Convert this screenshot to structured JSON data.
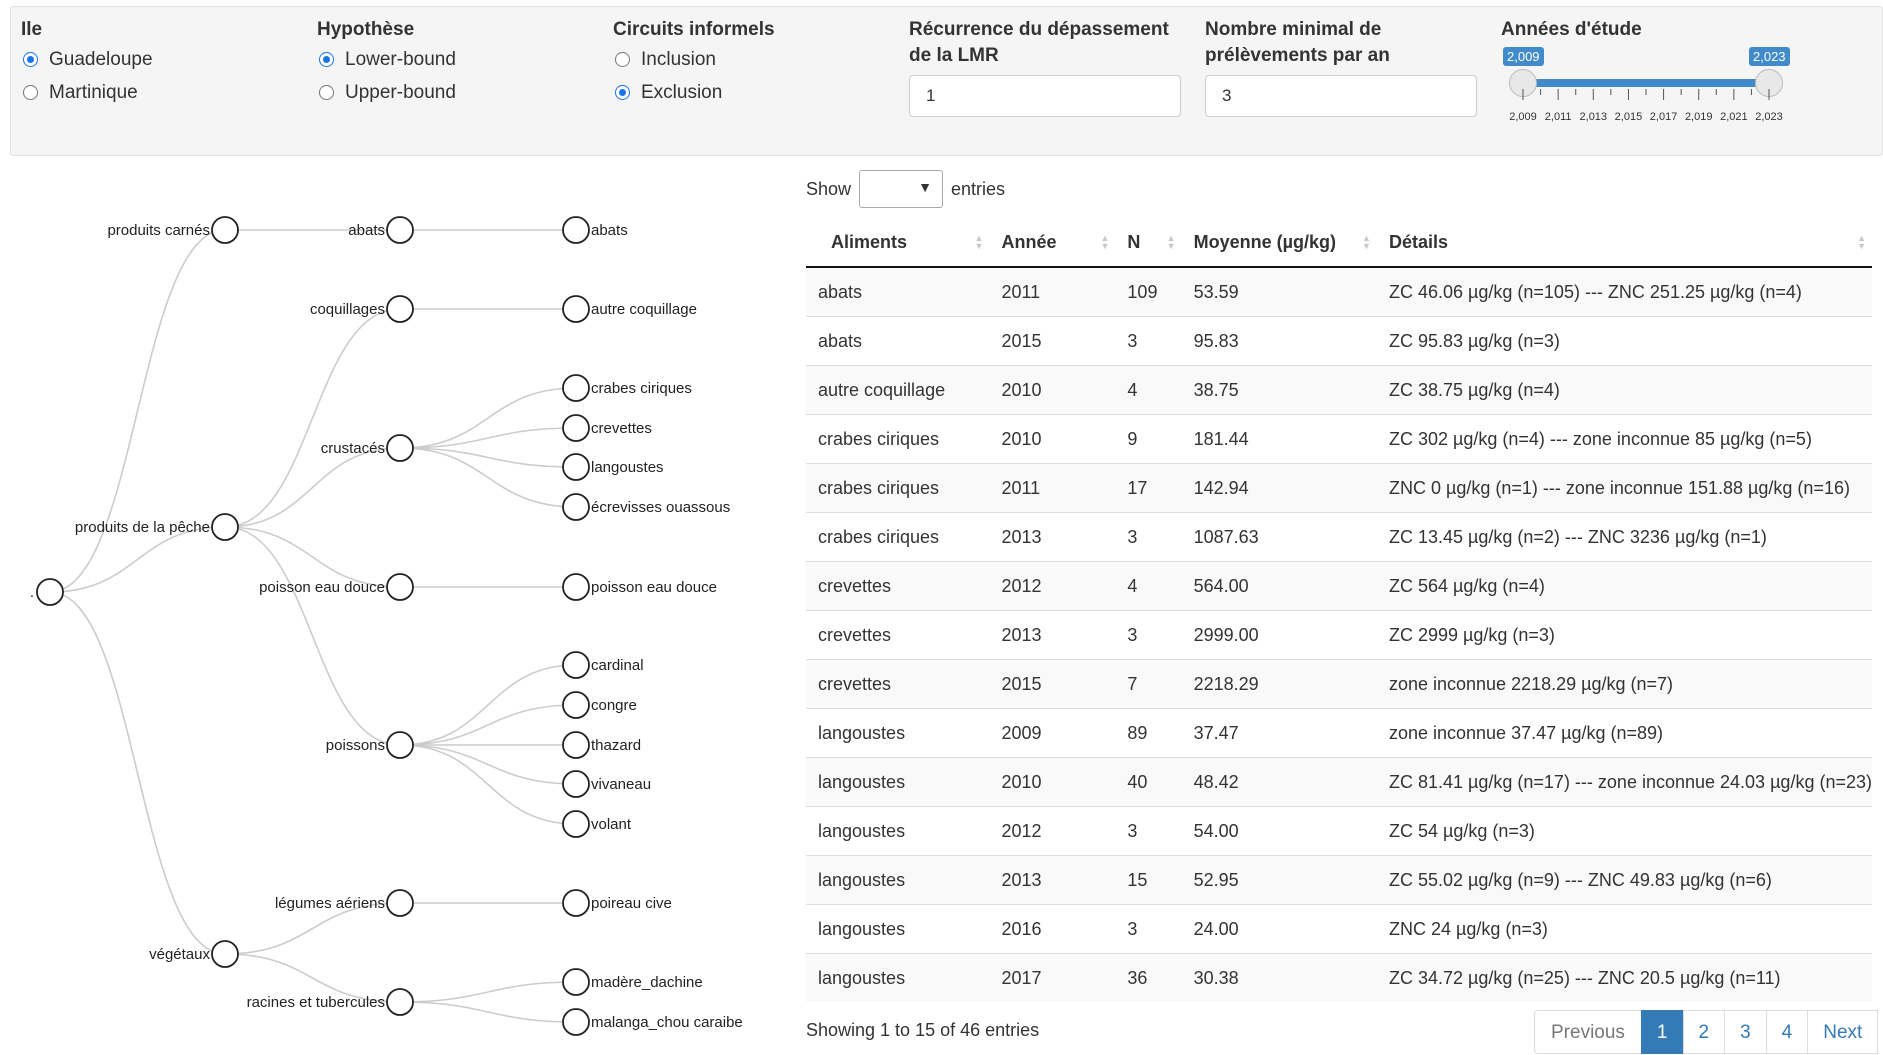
{
  "filters": {
    "ile": {
      "label": "Ile",
      "options": [
        "Guadeloupe",
        "Martinique"
      ],
      "selected": "Guadeloupe"
    },
    "hypothese": {
      "label": "Hypothèse",
      "options": [
        "Lower-bound",
        "Upper-bound"
      ],
      "selected": "Lower-bound"
    },
    "circuits": {
      "label": "Circuits informels",
      "options": [
        "Inclusion",
        "Exclusion"
      ],
      "selected": "Exclusion"
    },
    "recurrence": {
      "label_line1": "Récurrence du dépassement",
      "label_line2": "de la LMR",
      "value": "1"
    },
    "nombre": {
      "label_line1": "Nombre minimal de",
      "label_line2": "prélèvements par an",
      "value": "3"
    },
    "annees": {
      "label": "Années d'étude",
      "min_label": "2,009",
      "max_label": "2,023",
      "from": 2009,
      "to": 2023,
      "min": 2009,
      "max": 2023,
      "ticks": [
        "2,009",
        "2,011",
        "2,013",
        "2,015",
        "2,017",
        "2,019",
        "2,021",
        "2,023"
      ]
    }
  },
  "tree": {
    "root": ".",
    "level1": [
      "produits carnés",
      "produits de la pêche",
      "végétaux"
    ],
    "level2": [
      "abats",
      "coquillages",
      "crustacés",
      "poisson eau douce",
      "poissons",
      "légumes aériens",
      "racines et tubercules"
    ],
    "leaves": [
      "abats",
      "autre coquillage",
      "crabes ciriques",
      "crevettes",
      "langoustes",
      "écrevisses ouassous",
      "poisson eau douce",
      "cardinal",
      "congre",
      "thazard",
      "vivaneau",
      "volant",
      "poireau cive",
      "madère_dachine",
      "malanga_chou caraibe"
    ]
  },
  "table": {
    "show_label": "Show",
    "entries_label": "entries",
    "headers": [
      "Aliments",
      "Année",
      "N",
      "Moyenne (µg/kg)",
      "Détails"
    ],
    "rows": [
      [
        "abats",
        "2011",
        "109",
        "53.59",
        "ZC 46.06 µg/kg (n=105) --- ZNC 251.25 µg/kg (n=4)"
      ],
      [
        "abats",
        "2015",
        "3",
        "95.83",
        "ZC 95.83 µg/kg (n=3)"
      ],
      [
        "autre coquillage",
        "2010",
        "4",
        "38.75",
        "ZC 38.75 µg/kg (n=4)"
      ],
      [
        "crabes ciriques",
        "2010",
        "9",
        "181.44",
        "ZC 302 µg/kg (n=4) --- zone inconnue 85 µg/kg (n=5)"
      ],
      [
        "crabes ciriques",
        "2011",
        "17",
        "142.94",
        "ZNC 0 µg/kg (n=1) --- zone inconnue 151.88 µg/kg (n=16)"
      ],
      [
        "crabes ciriques",
        "2013",
        "3",
        "1087.63",
        "ZC 13.45 µg/kg (n=2) --- ZNC 3236 µg/kg (n=1)"
      ],
      [
        "crevettes",
        "2012",
        "4",
        "564.00",
        "ZC 564 µg/kg (n=4)"
      ],
      [
        "crevettes",
        "2013",
        "3",
        "2999.00",
        "ZC 2999 µg/kg (n=3)"
      ],
      [
        "crevettes",
        "2015",
        "7",
        "2218.29",
        "zone inconnue 2218.29 µg/kg (n=7)"
      ],
      [
        "langoustes",
        "2009",
        "89",
        "37.47",
        "zone inconnue 37.47 µg/kg (n=89)"
      ],
      [
        "langoustes",
        "2010",
        "40",
        "48.42",
        "ZC 81.41 µg/kg (n=17) --- zone inconnue 24.03 µg/kg (n=23)"
      ],
      [
        "langoustes",
        "2012",
        "3",
        "54.00",
        "ZC 54 µg/kg (n=3)"
      ],
      [
        "langoustes",
        "2013",
        "15",
        "52.95",
        "ZC 55.02 µg/kg (n=9) --- ZNC 49.83 µg/kg (n=6)"
      ],
      [
        "langoustes",
        "2016",
        "3",
        "24.00",
        "ZNC 24 µg/kg (n=3)"
      ],
      [
        "langoustes",
        "2017",
        "36",
        "30.38",
        "ZC 34.72 µg/kg (n=25) --- ZNC 20.5 µg/kg (n=11)"
      ]
    ],
    "info": "Showing 1 to 15 of 46 entries",
    "pagination": {
      "previous": "Previous",
      "pages": [
        "1",
        "2",
        "3",
        "4"
      ],
      "active": "1",
      "next": "Next"
    }
  },
  "colors": {
    "accent": "#428bca",
    "radio": "#1a73e8",
    "page_active": "#337ab7"
  }
}
